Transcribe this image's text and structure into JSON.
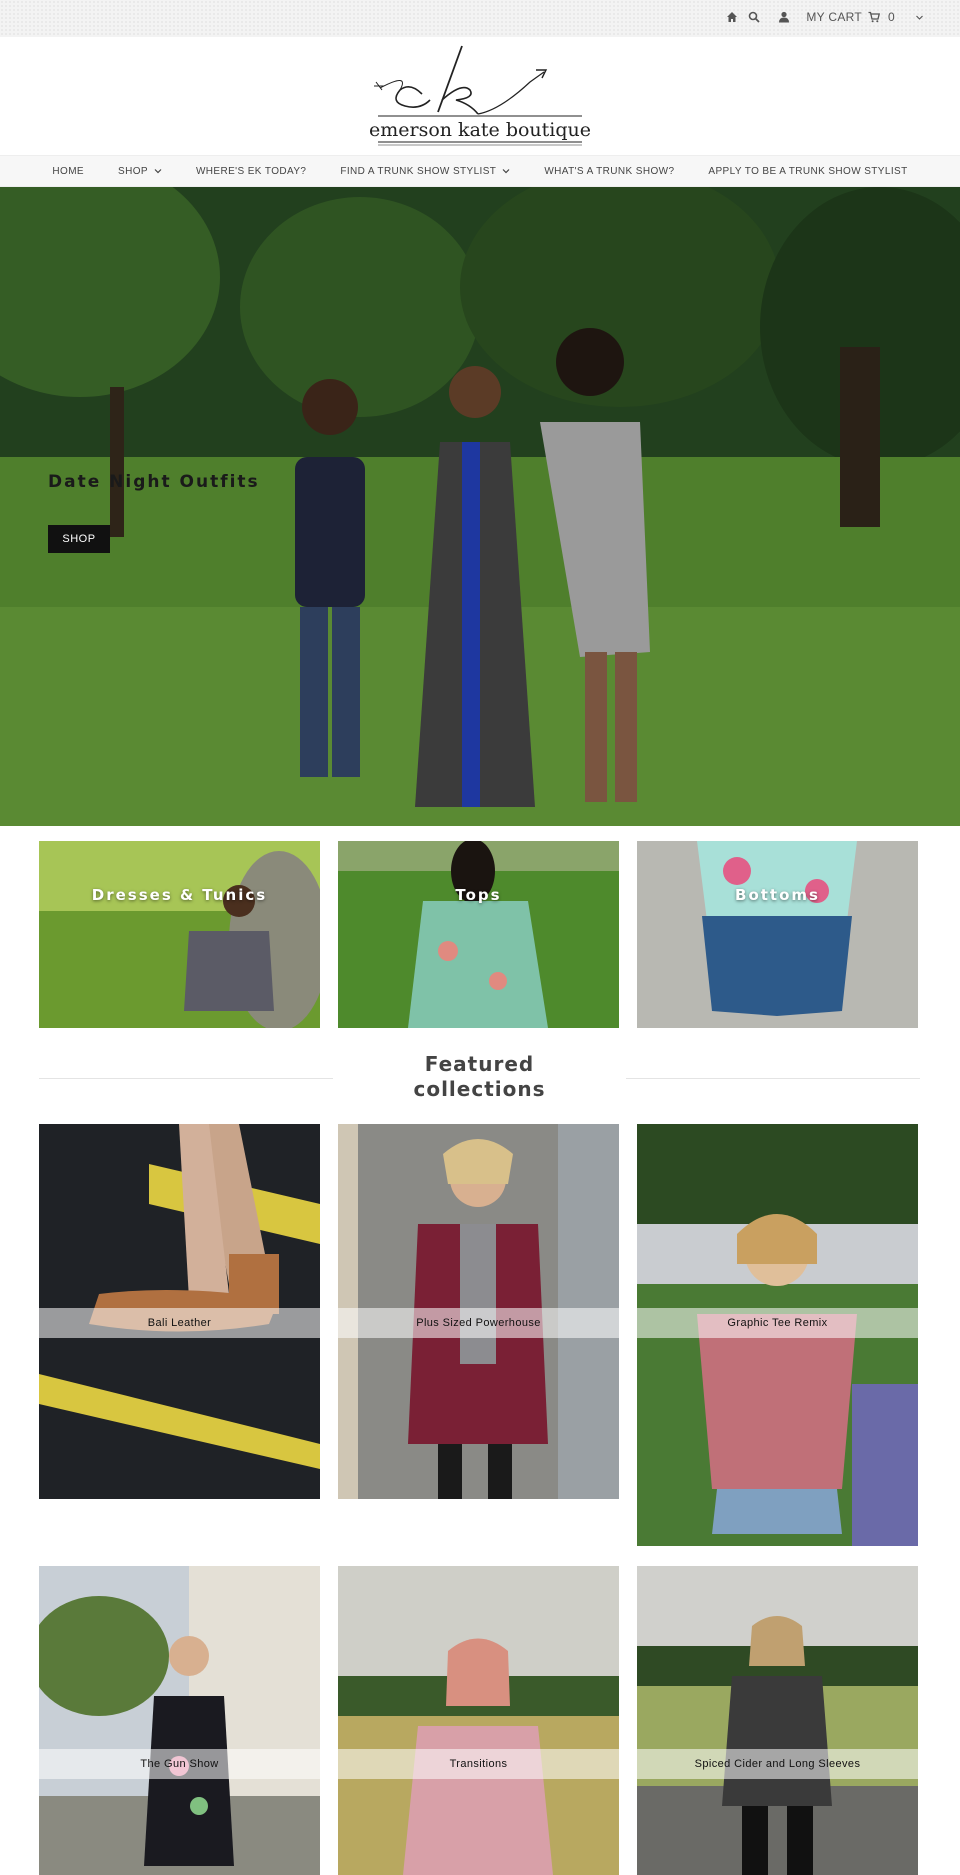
{
  "topbar": {
    "cart_label": "MY CART",
    "cart_count": "0",
    "icons": [
      "home-icon",
      "search-icon",
      "user-icon",
      "cart-icon",
      "chevron-down-icon"
    ]
  },
  "brand": {
    "logo_monogram": "ek",
    "logo_text": "emerson kate boutique"
  },
  "nav": {
    "items": [
      {
        "label": "HOME"
      },
      {
        "label": "SHOP"
      },
      {
        "label": "WHERE'S EK TODAY?"
      },
      {
        "label": "FIND A TRUNK SHOW STYLIST"
      },
      {
        "label": "WHAT'S A TRUNK SHOW?"
      },
      {
        "label": "APPLY TO BE A TRUNK SHOW STYLIST"
      }
    ]
  },
  "hero": {
    "title": "Date Night Outfits",
    "button_label": "SHOP"
  },
  "categories": [
    {
      "label": "Dresses & Tunics"
    },
    {
      "label": "Tops"
    },
    {
      "label": "Bottoms"
    }
  ],
  "featured": {
    "title_line1": "Featured",
    "title_line2": "collections"
  },
  "collections": [
    {
      "label": "Bali Leather"
    },
    {
      "label": "Plus Sized Powerhouse"
    },
    {
      "label": "Graphic Tee Remix"
    },
    {
      "label": "The Gun Show"
    },
    {
      "label": "Transitions"
    },
    {
      "label": "Spiced Cider and Long Sleeves"
    }
  ],
  "colors": {
    "accent": "#111111",
    "nav_bg": "#f7f7f7",
    "topbar_bg": "#f3f3f3"
  }
}
